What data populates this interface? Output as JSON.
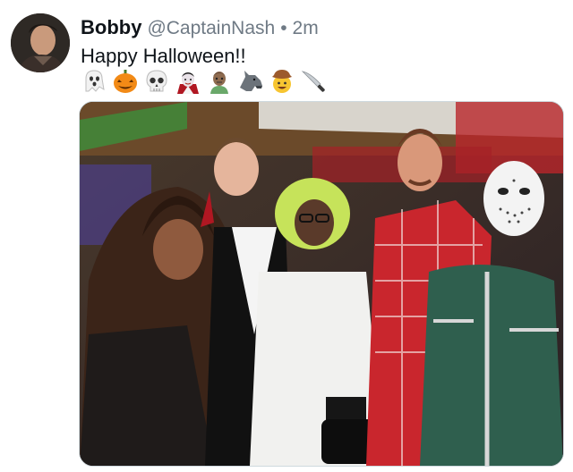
{
  "tweet": {
    "author_name": "Bobby",
    "author_handle": "@CaptainNash",
    "separator": "•",
    "timestamp": "2m",
    "text": "Happy Halloween!!",
    "emojis": [
      "ghost-emoji",
      "jack-o-lantern-emoji",
      "skull-emoji",
      "vampire-emoji",
      "zombie-emoji",
      "wolf-emoji",
      "cowboy-emoji",
      "knife-emoji"
    ]
  },
  "colors": {
    "text_primary": "#0f1419",
    "text_secondary": "#6f7a85",
    "media_border": "#cfd9de"
  }
}
